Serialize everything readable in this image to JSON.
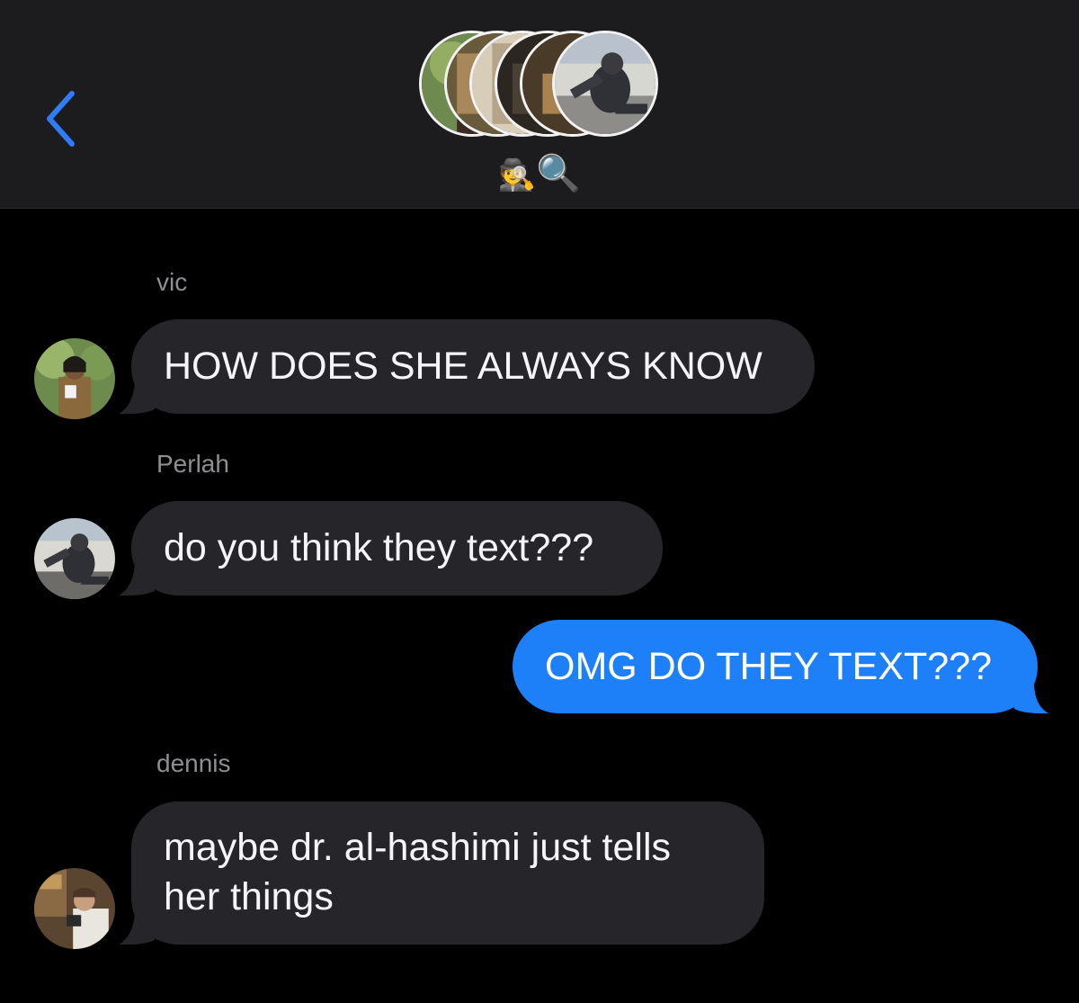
{
  "header": {
    "back_icon": "chevron-left-icon",
    "group_avatars": [
      "vic-avatar",
      "group-member-2-avatar",
      "group-member-3-avatar",
      "dennis-avatar",
      "group-member-5-avatar",
      "perlah-avatar"
    ],
    "group_name": "🕵️🔍",
    "group_name_parts": [
      "🕵",
      "🔍"
    ]
  },
  "messages": [
    {
      "sender": "vic",
      "text": "HOW DOES SHE ALWAYS KNOW",
      "direction": "incoming"
    },
    {
      "sender": "Perlah",
      "text": "do you think they text???",
      "direction": "incoming"
    },
    {
      "sender": "",
      "text": "OMG DO THEY TEXT???",
      "direction": "outgoing"
    },
    {
      "sender": "dennis",
      "text_lines": [
        "maybe dr. al-hashimi just tells",
        "her things"
      ],
      "direction": "incoming"
    }
  ],
  "colors": {
    "background": "#000000",
    "header_background": "#1c1c1e",
    "incoming_bubble": "#26262a",
    "outgoing_bubble": "#1e80f8",
    "accent": "#2f7cf6",
    "sender_name": "#8e8e93"
  }
}
